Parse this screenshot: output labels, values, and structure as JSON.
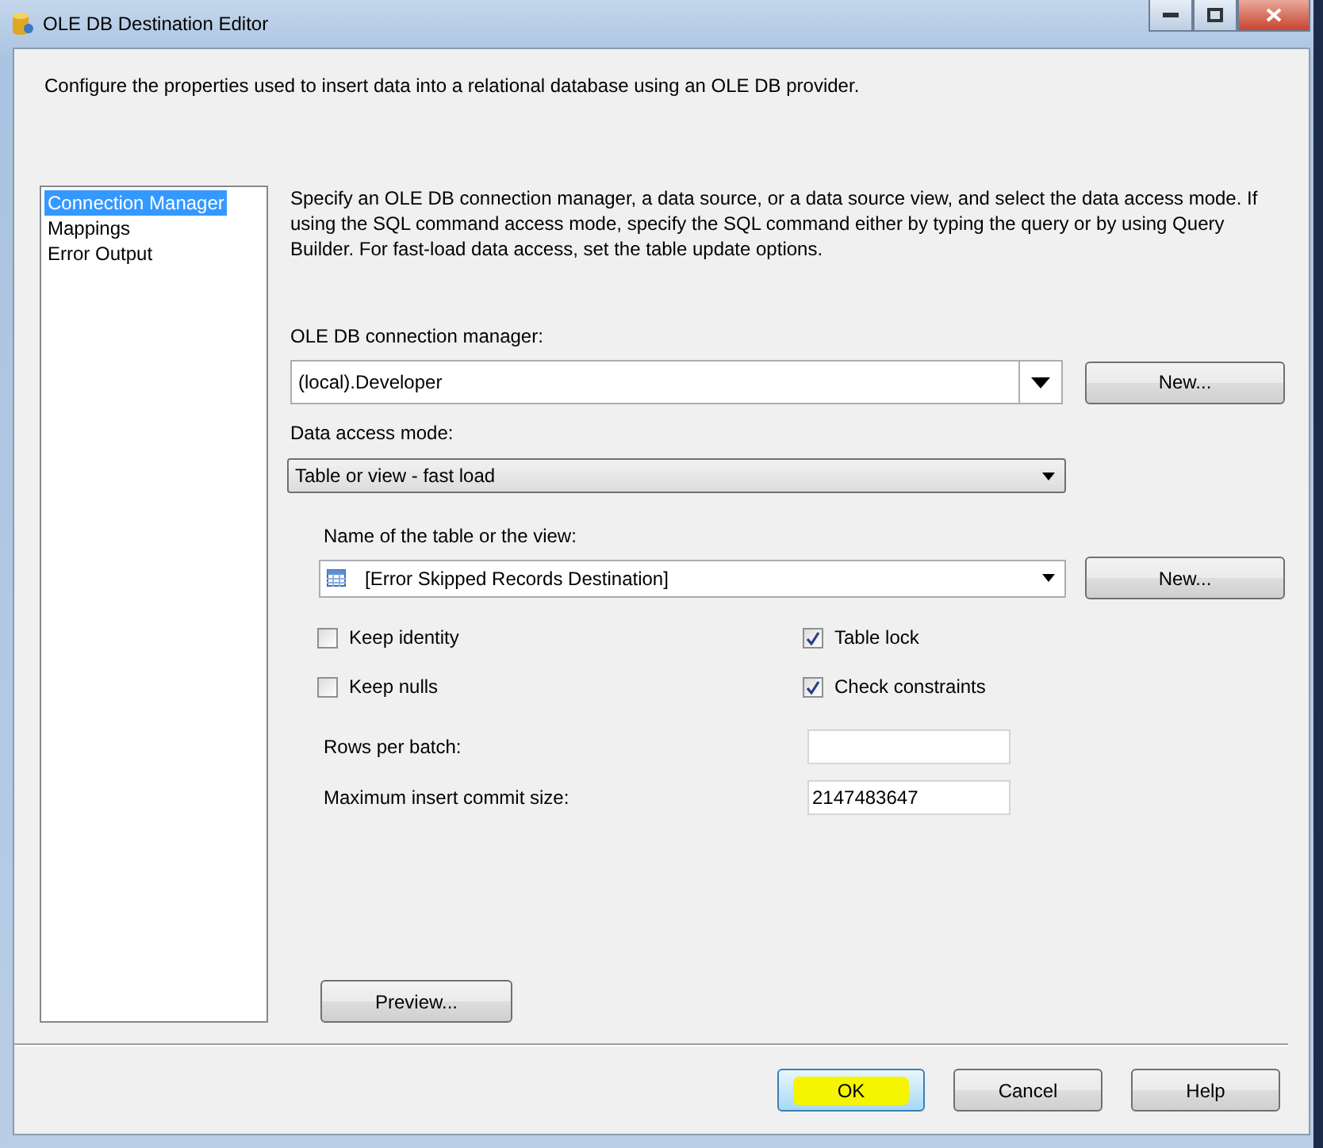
{
  "window": {
    "title": "OLE DB Destination Editor"
  },
  "description": "Configure the properties used to insert data into a relational database using an OLE DB provider.",
  "pages": [
    {
      "label": "Connection Manager",
      "selected": true
    },
    {
      "label": "Mappings",
      "selected": false
    },
    {
      "label": "Error Output",
      "selected": false
    }
  ],
  "instructions": "Specify an OLE DB connection manager, a data source, or a data source view, and select the data access mode. If using the SQL command access mode, specify the SQL command either by typing the query or by using Query Builder. For fast-load data access, set the table update options.",
  "connection_manager": {
    "label": "OLE DB connection manager:",
    "value": "(local).Developer",
    "button": "New..."
  },
  "data_access_mode": {
    "label": "Data access mode:",
    "value": "Table or view - fast load"
  },
  "table_name": {
    "label": "Name of the table or the view:",
    "value": "[Error Skipped Records Destination]",
    "button": "New..."
  },
  "options": [
    {
      "label": "Keep identity",
      "checked": false
    },
    {
      "label": "Table lock",
      "checked": true
    },
    {
      "label": "Keep nulls",
      "checked": false
    },
    {
      "label": "Check constraints",
      "checked": true
    }
  ],
  "fields": [
    {
      "label": "Rows per batch:"
    },
    {
      "label": "Maximum insert commit size:",
      "value": "2147483647"
    }
  ],
  "preview_button": "Preview...",
  "buttons": [
    {
      "label": "OK",
      "highlighted": true
    },
    {
      "label": "Cancel",
      "highlighted": false
    },
    {
      "label": "Help",
      "highlighted": false
    }
  ]
}
